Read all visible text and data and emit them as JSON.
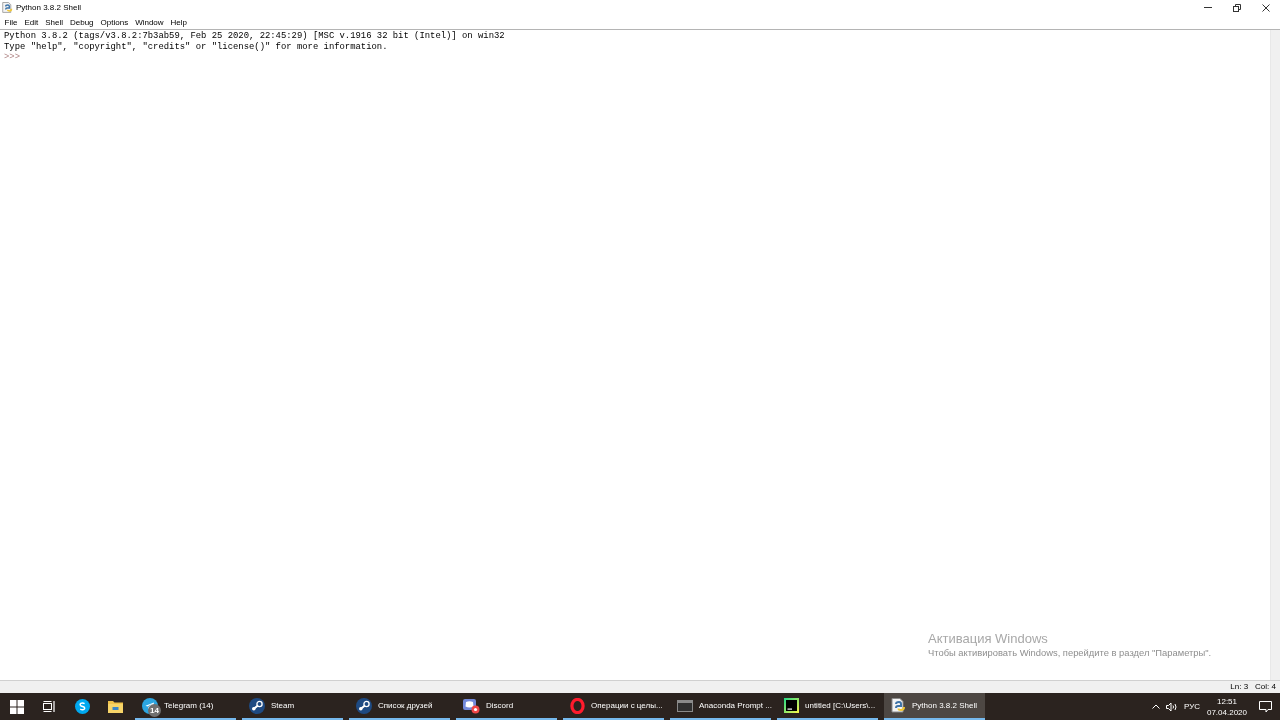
{
  "window": {
    "title": "Python 3.8.2 Shell"
  },
  "menu": [
    {
      "label": "File"
    },
    {
      "label": "Edit"
    },
    {
      "label": "Shell"
    },
    {
      "label": "Debug"
    },
    {
      "label": "Options"
    },
    {
      "label": "Window"
    },
    {
      "label": "Help"
    }
  ],
  "shell": {
    "lines": [
      {
        "kind": "output",
        "text": "Python 3.8.2 (tags/v3.8.2:7b3ab59, Feb 25 2020, 22:45:29) [MSC v.1916 32 bit (Intel)] on win32"
      },
      {
        "kind": "output",
        "text": "Type \"help\", \"copyright\", \"credits\" or \"license()\" for more information."
      },
      {
        "kind": "prompt",
        "text": ">>>"
      }
    ]
  },
  "activation_notice": {
    "title": "Активация Windows",
    "text": "Чтобы активировать Windows, перейдите в раздел \"Параметры\"."
  },
  "status_bar": {
    "line": "Ln: 3",
    "column": "Col: 4"
  },
  "taskbar": {
    "apps": [
      {
        "kind": "telegram",
        "label": "Telegram (14)",
        "badge": "14",
        "selected": false
      },
      {
        "kind": "steam",
        "label": "Steam",
        "selected": false
      },
      {
        "kind": "steam",
        "label": "Список друзей",
        "selected": false
      },
      {
        "kind": "discord",
        "label": "Discord",
        "selected": false
      },
      {
        "kind": "opera",
        "label": "Операции с целы...",
        "selected": false
      },
      {
        "kind": "terminal",
        "label": "Anaconda Prompt ...",
        "selected": false
      },
      {
        "kind": "pycharm",
        "label": "untitled [C:\\Users\\...",
        "selected": false
      },
      {
        "kind": "idle",
        "label": "Python 3.8.2 Shell",
        "selected": true
      }
    ],
    "tray": {
      "language": "РУС",
      "time": "12:51",
      "date": "07.04.2020"
    }
  }
}
